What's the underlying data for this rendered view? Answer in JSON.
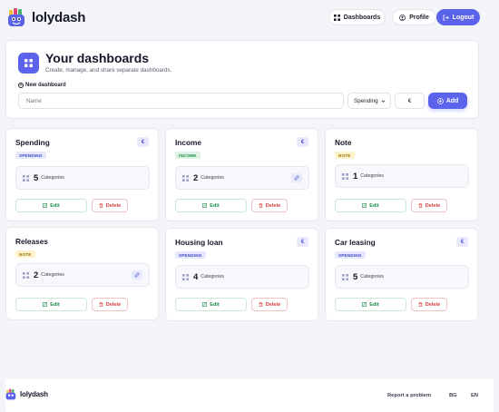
{
  "app": {
    "name": "lolydash",
    "accent_color": "#5b63ea"
  },
  "nav": {
    "dashboards_label": "Dashboards",
    "profile_label": "Profile",
    "logout_label": "Logout"
  },
  "hero": {
    "title": "Your dashboards",
    "subtitle": "Create, manage, and share separate dashboards.",
    "new_label": "New dashboard",
    "name_placeholder": "Name",
    "type_value": "Spending",
    "currency_value": "€",
    "add_label": "Add"
  },
  "cards": [
    {
      "title": "Spending",
      "currency": "€",
      "type": "SPENDING",
      "count": "5",
      "count_label": "Categories",
      "edit": "Edit",
      "delete": "Delete"
    },
    {
      "title": "Income",
      "currency": "€",
      "type": "INCOME",
      "count": "2",
      "count_label": "Categories",
      "edit": "Edit",
      "delete": "Delete"
    },
    {
      "title": "Note",
      "type": "NOTE",
      "count": "1",
      "count_label": "Categories",
      "edit": "Edit",
      "delete": "Delete"
    },
    {
      "title": "Releases",
      "type": "NOTE",
      "count": "2",
      "count_label": "Categories",
      "edit": "Edit",
      "delete": "Delete"
    },
    {
      "title": "Housing loan",
      "currency": "€",
      "type": "SPENDING",
      "count": "4",
      "count_label": "Categories",
      "edit": "Edit",
      "delete": "Delete"
    },
    {
      "title": "Car leasing",
      "currency": "€",
      "type": "SPENDING",
      "count": "5",
      "count_label": "Categories",
      "edit": "Edit",
      "delete": "Delete"
    }
  ],
  "footer": {
    "brand": "lolydash",
    "report_label": "Report a problem",
    "lang_bg": "BG",
    "lang_en": "EN"
  }
}
